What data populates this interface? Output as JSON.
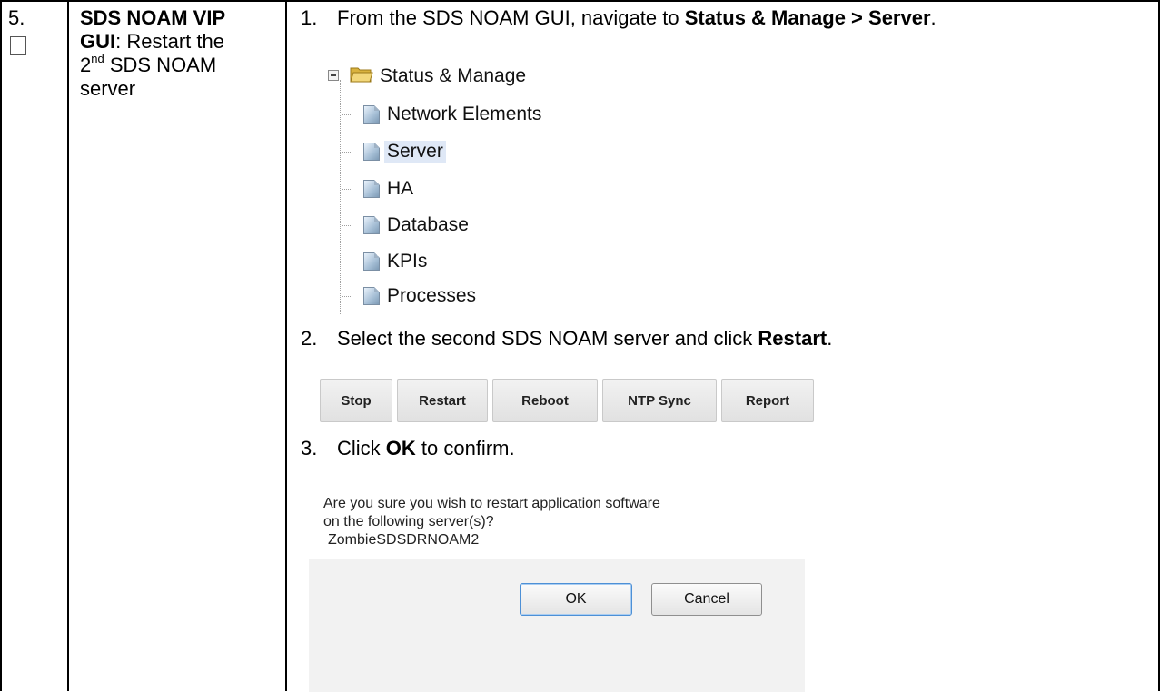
{
  "step": {
    "number": "5.",
    "title_bold": "SDS NOAM VIP GUI",
    "title_line1_bold": "SDS NOAM VIP",
    "title_line2_bold": "GUI",
    "title_line2_rest": ":  Restart the",
    "title_line3_pre": "2",
    "title_line3_sup": "nd",
    "title_line3_rest": " SDS NOAM",
    "title_line4": "server"
  },
  "instructions": [
    {
      "num": "1.",
      "text_before": "From the SDS NOAM GUI, navigate to ",
      "text_bold": "Status & Manage > Server",
      "text_after": "."
    },
    {
      "num": "2.",
      "text_before": "Select the second SDS NOAM server and click ",
      "text_bold": "Restart",
      "text_after": "."
    },
    {
      "num": "3.",
      "text_before": "Click ",
      "text_bold": "OK",
      "text_after": " to confirm."
    }
  ],
  "tree": {
    "root": "Status & Manage",
    "items": [
      "Network Elements",
      "Server",
      "HA",
      "Database",
      "KPIs",
      "Processes"
    ],
    "selected": "Server"
  },
  "toolbar": {
    "buttons": [
      "Stop",
      "Restart",
      "Reboot",
      "NTP Sync",
      "Report"
    ]
  },
  "dialog": {
    "line1": "Are you sure you wish to restart application software",
    "line2": "on the following server(s)?",
    "server": "ZombieSDSDRNOAM2",
    "ok_label": "OK",
    "cancel_label": "Cancel"
  },
  "colors": {
    "selected_bg": "#dfe8f6",
    "folder": "#e8c75a",
    "ok_border": "#4d90d6"
  }
}
